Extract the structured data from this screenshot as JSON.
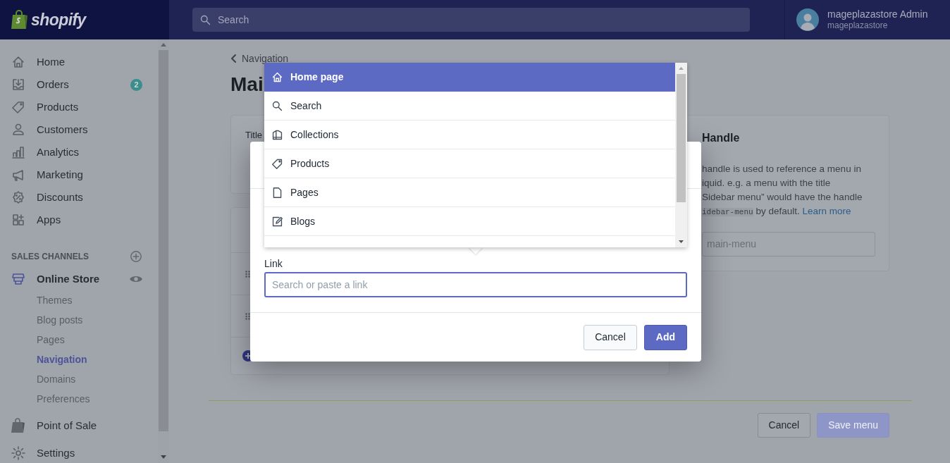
{
  "topbar": {
    "brand": "shopify",
    "search": {
      "placeholder": "Search"
    },
    "user": {
      "name": "mageplazastore Admin",
      "store": "mageplazastore"
    }
  },
  "sidebar": {
    "items": [
      {
        "label": "Home"
      },
      {
        "label": "Orders",
        "badge": "2"
      },
      {
        "label": "Products"
      },
      {
        "label": "Customers"
      },
      {
        "label": "Analytics"
      },
      {
        "label": "Marketing"
      },
      {
        "label": "Discounts"
      },
      {
        "label": "Apps"
      }
    ],
    "sales_channels": {
      "heading": "SALES CHANNELS",
      "channels": [
        {
          "label": "Online Store",
          "selected": true,
          "children": [
            {
              "label": "Themes",
              "selected": false
            },
            {
              "label": "Blog posts",
              "selected": false
            },
            {
              "label": "Pages",
              "selected": false
            },
            {
              "label": "Navigation",
              "selected": true
            },
            {
              "label": "Domains",
              "selected": false
            },
            {
              "label": "Preferences",
              "selected": false
            }
          ]
        },
        {
          "label": "Point of Sale",
          "selected": false
        }
      ]
    },
    "settings": "Settings"
  },
  "page": {
    "breadcrumb": "Navigation",
    "title": "Mai",
    "title_label": "Title",
    "handle_card": {
      "heading": "Handle",
      "lines": [
        "handle is used to reference a menu in",
        "iquid. e.g. a menu with the title",
        "Sidebar menu” would have the handle"
      ],
      "code": "idebar-menu",
      "text_after": "by default.",
      "link": "Learn more",
      "field": {
        "placeholder": "main-menu"
      }
    },
    "buttons": [
      {
        "label": "Cancel",
        "disabled": false
      },
      {
        "label": "Save menu",
        "disabled": true
      }
    ]
  },
  "modal": {
    "link_label": "Link",
    "link_field": {
      "placeholder": "Search or paste a link"
    },
    "buttons": [
      {
        "label": "Cancel",
        "kind": "secondary"
      },
      {
        "label": "Add",
        "kind": "primary"
      }
    ]
  },
  "dropdown": {
    "options": [
      {
        "label": "Home page",
        "selected": true
      },
      {
        "label": "Search",
        "selected": false
      },
      {
        "label": "Collections",
        "selected": false
      },
      {
        "label": "Products",
        "selected": false
      },
      {
        "label": "Pages",
        "selected": false
      },
      {
        "label": "Blogs",
        "selected": false
      }
    ]
  }
}
